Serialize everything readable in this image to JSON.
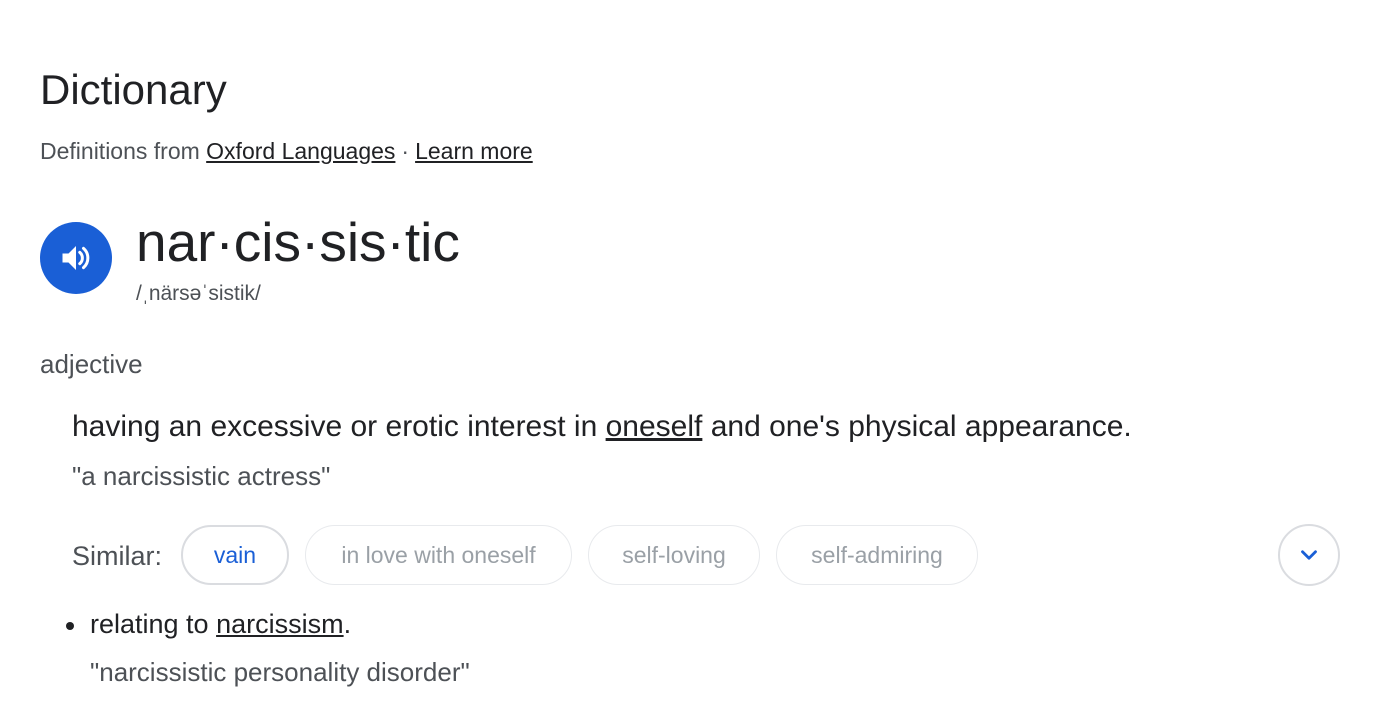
{
  "header": {
    "title": "Dictionary",
    "source_prefix": "Definitions from",
    "source_link": "Oxford Languages",
    "separator": "·",
    "learn_more": "Learn more"
  },
  "entry": {
    "headword": "nar·cis·sis·tic",
    "phonetic": "/ˌnärsəˈsistik/",
    "part_of_speech": "adjective",
    "senses": [
      {
        "definition_before": "having an excessive or erotic interest in ",
        "definition_link": "oneself",
        "definition_after": " and one's physical appearance.",
        "example": "\"a narcissistic actress\""
      },
      {
        "definition_before": "relating to ",
        "definition_link": "narcissism",
        "definition_after": ".",
        "example": "\"narcissistic personality disorder\""
      }
    ],
    "similar": {
      "label": "Similar:",
      "chips": [
        "vain",
        "in love with oneself",
        "self-loving",
        "self-admiring"
      ]
    }
  },
  "icons": {
    "speaker": "speaker-icon",
    "expand": "chevron-down-icon"
  },
  "colors": {
    "accent": "#1a5fd6",
    "text": "#202124",
    "secondary_text": "#4d5156",
    "muted_chip_text": "#9aa0a6"
  }
}
